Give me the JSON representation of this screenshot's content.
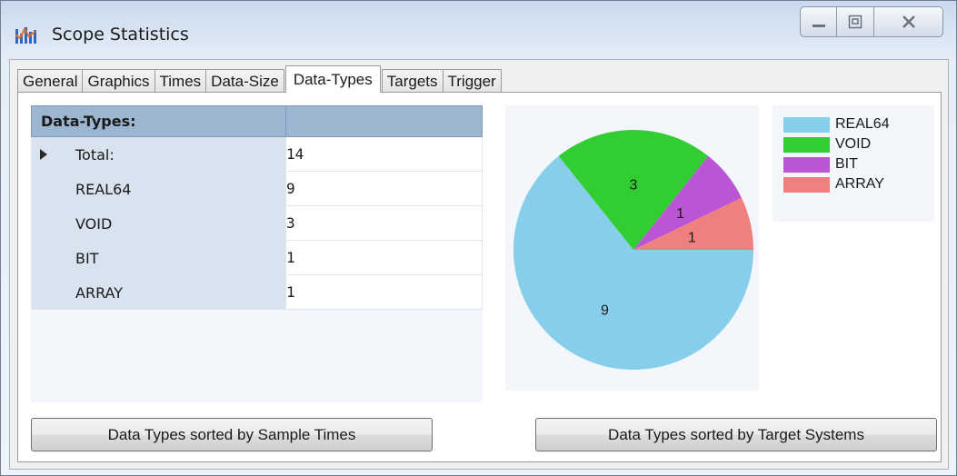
{
  "window": {
    "title": "Scope Statistics"
  },
  "tabs": [
    {
      "label": "General"
    },
    {
      "label": "Graphics"
    },
    {
      "label": "Times"
    },
    {
      "label": "Data-Size"
    },
    {
      "label": "Data-Types",
      "active": true
    },
    {
      "label": "Targets"
    },
    {
      "label": "Trigger"
    }
  ],
  "grid": {
    "headers": [
      "Data-Types:",
      ""
    ],
    "rows": [
      {
        "name": "Total:",
        "value": "14",
        "selected": true
      },
      {
        "name": "REAL64",
        "value": "9"
      },
      {
        "name": "VOID",
        "value": "3"
      },
      {
        "name": "BIT",
        "value": "1"
      },
      {
        "name": "ARRAY",
        "value": "1"
      }
    ]
  },
  "chart_data": {
    "type": "pie",
    "slices": [
      {
        "label": "REAL64",
        "value": 9,
        "color": "#87ceeb"
      },
      {
        "label": "VOID",
        "value": 3,
        "color": "#32cd32"
      },
      {
        "label": "BIT",
        "value": 1,
        "color": "#ba55d3"
      },
      {
        "label": "ARRAY",
        "value": 1,
        "color": "#f08080"
      }
    ],
    "legend": [
      "REAL64",
      "VOID",
      "BIT",
      "ARRAY"
    ],
    "legend_position": "right"
  },
  "buttons": {
    "sort_sample_times": "Data Types sorted by Sample Times",
    "sort_target_systems": "Data Types sorted by Target Systems"
  },
  "icons": {
    "app": "scope-icon",
    "minimize": "minimize-icon",
    "maximize": "maximize-icon",
    "close": "close-icon"
  }
}
